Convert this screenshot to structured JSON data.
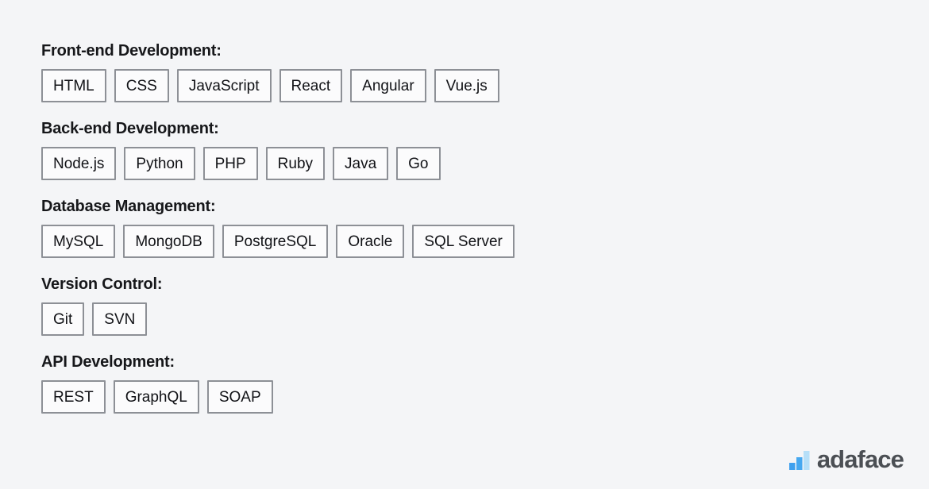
{
  "page": {
    "background_color": "#f4f5f7",
    "text_color": "#16171a"
  },
  "sections": [
    {
      "id": "front-end-development",
      "title": "Front-end Development:",
      "items": [
        "HTML",
        "CSS",
        "JavaScript",
        "React",
        "Angular",
        "Vue.js"
      ]
    },
    {
      "id": "back-end-development",
      "title": "Back-end Development:",
      "items": [
        "Node.js",
        "Python",
        "PHP",
        "Ruby",
        "Java",
        "Go"
      ]
    },
    {
      "id": "database-management",
      "title": "Database Management:",
      "items": [
        "MySQL",
        "MongoDB",
        "PostgreSQL",
        "Oracle",
        "SQL Server"
      ]
    },
    {
      "id": "version-control",
      "title": "Version Control:",
      "items": [
        "Git",
        "SVN"
      ]
    },
    {
      "id": "api-development",
      "title": "API Development:",
      "items": [
        "REST",
        "GraphQL",
        "SOAP"
      ]
    }
  ],
  "brand": {
    "name": "adaface",
    "icon": "bar-chart-icon",
    "name_color": "#4b4f54",
    "bar_colors": [
      "#3fa0ee",
      "#46a8f0",
      "#b6dff8"
    ]
  }
}
